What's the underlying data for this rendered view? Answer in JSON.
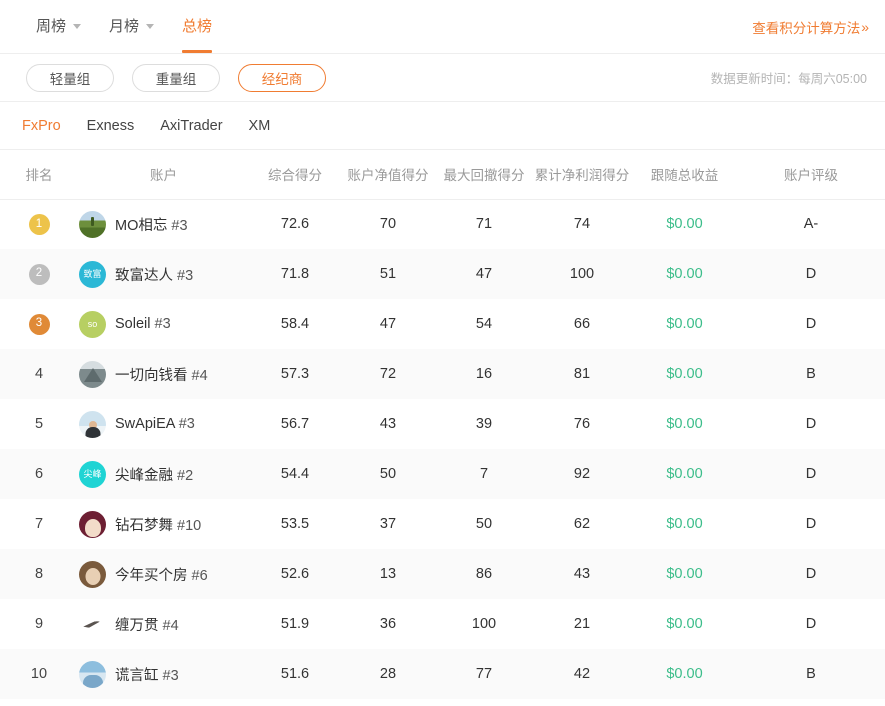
{
  "header": {
    "period_tabs": [
      {
        "label": "周榜",
        "has_caret": true,
        "active": false
      },
      {
        "label": "月榜",
        "has_caret": true,
        "active": false
      },
      {
        "label": "总榜",
        "has_caret": false,
        "active": true
      }
    ],
    "scoring_link": "查看积分计算方法",
    "scoring_link_chevrons": "》"
  },
  "filters": {
    "pills": [
      {
        "label": "轻量组",
        "active": false
      },
      {
        "label": "重量组",
        "active": false
      },
      {
        "label": "经纪商",
        "active": true
      }
    ],
    "update_note": "数据更新时间：每周六05:00"
  },
  "brokers": [
    {
      "label": "FxPro",
      "active": true
    },
    {
      "label": "Exness",
      "active": false
    },
    {
      "label": "AxiTrader",
      "active": false
    },
    {
      "label": "XM",
      "active": false
    }
  ],
  "table": {
    "columns": [
      "排名",
      "账户",
      "综合得分",
      "账户净值得分",
      "最大回撤得分",
      "累计净利润得分",
      "跟随总收益",
      "账户评级"
    ],
    "rows": [
      {
        "rank": "1",
        "badge": "gold",
        "avatar": "av-field",
        "avatar_text": "",
        "name": "MO相忘",
        "suffix": "#3",
        "total": "72.6",
        "equity": "70",
        "drawdown": "71",
        "profit": "74",
        "follow": "$0.00",
        "grade": "A-"
      },
      {
        "rank": "2",
        "badge": "silver",
        "avatar": "av-teal",
        "avatar_text": "致富",
        "name": "致富达人",
        "suffix": "#3",
        "total": "71.8",
        "equity": "51",
        "drawdown": "47",
        "profit": "100",
        "follow": "$0.00",
        "grade": "D"
      },
      {
        "rank": "3",
        "badge": "bronze",
        "avatar": "av-green",
        "avatar_text": "so",
        "name": "Soleil",
        "suffix": "#3",
        "total": "58.4",
        "equity": "47",
        "drawdown": "54",
        "profit": "66",
        "follow": "$0.00",
        "grade": "D"
      },
      {
        "rank": "4",
        "badge": "none",
        "avatar": "av-mtn",
        "avatar_text": "",
        "name": "一切向钱看",
        "suffix": "#4",
        "total": "57.3",
        "equity": "72",
        "drawdown": "16",
        "profit": "81",
        "follow": "$0.00",
        "grade": "B"
      },
      {
        "rank": "5",
        "badge": "none",
        "avatar": "av-person",
        "avatar_text": "",
        "name": "SwApiEA",
        "suffix": "#3",
        "total": "56.7",
        "equity": "43",
        "drawdown": "39",
        "profit": "76",
        "follow": "$0.00",
        "grade": "D"
      },
      {
        "rank": "6",
        "badge": "none",
        "avatar": "av-cyan",
        "avatar_text": "尖峰",
        "name": "尖峰金融",
        "suffix": "#2",
        "total": "54.4",
        "equity": "50",
        "drawdown": "7",
        "profit": "92",
        "follow": "$0.00",
        "grade": "D"
      },
      {
        "rank": "7",
        "badge": "none",
        "avatar": "av-maroon",
        "avatar_text": "",
        "name": "钻石梦舞",
        "suffix": "#10",
        "total": "53.5",
        "equity": "37",
        "drawdown": "50",
        "profit": "62",
        "follow": "$0.00",
        "grade": "D"
      },
      {
        "rank": "8",
        "badge": "none",
        "avatar": "av-brown",
        "avatar_text": "",
        "name": "今年买个房",
        "suffix": "#6",
        "total": "52.6",
        "equity": "13",
        "drawdown": "86",
        "profit": "43",
        "follow": "$0.00",
        "grade": "D"
      },
      {
        "rank": "9",
        "badge": "none",
        "avatar": "av-white",
        "avatar_text": "",
        "name": "缠万贯",
        "suffix": "#4",
        "total": "51.9",
        "equity": "36",
        "drawdown": "100",
        "profit": "21",
        "follow": "$0.00",
        "grade": "D"
      },
      {
        "rank": "10",
        "badge": "none",
        "avatar": "av-blue",
        "avatar_text": "",
        "name": "谎言缸",
        "suffix": "#3",
        "total": "51.6",
        "equity": "28",
        "drawdown": "77",
        "profit": "42",
        "follow": "$0.00",
        "grade": "B"
      }
    ]
  },
  "colors": {
    "accent": "#f07c32",
    "money_green": "#3bbd8a",
    "rank_gold": "#edc34a",
    "rank_silver": "#bdbdbd",
    "rank_bronze": "#e08a37",
    "row_alt": "#fafafa"
  }
}
